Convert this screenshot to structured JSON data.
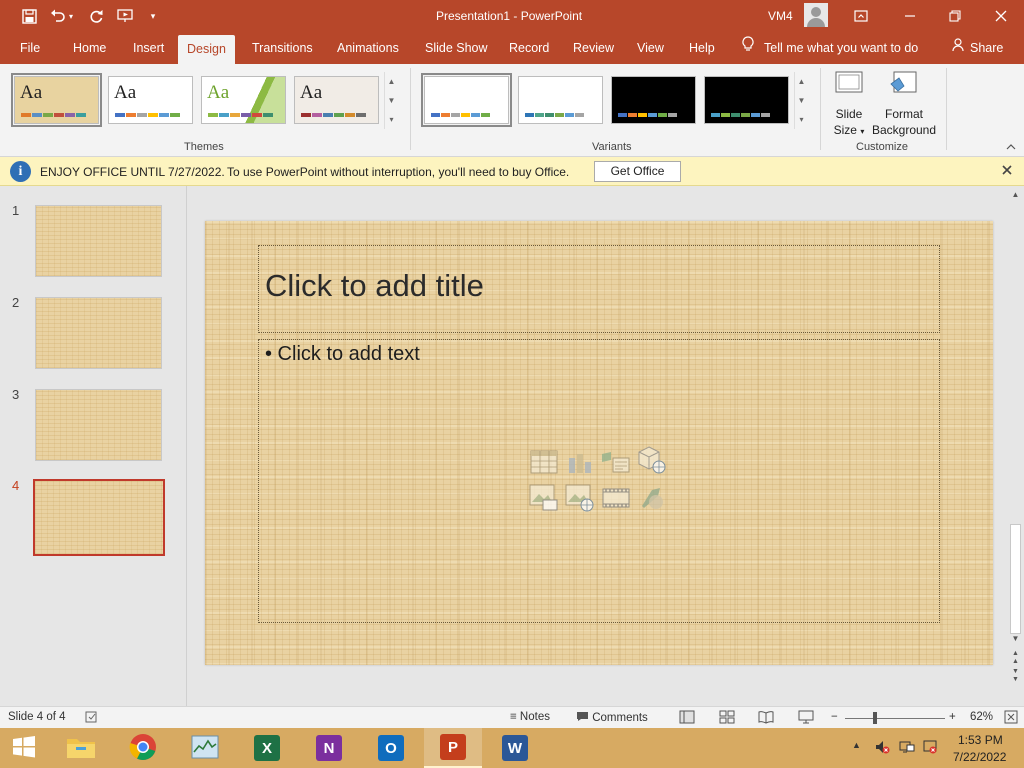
{
  "titlebar": {
    "title": "Presentation1  -  PowerPoint",
    "user": "VM4",
    "qat_icons": [
      "save-icon",
      "undo-icon",
      "undo-dropdown-icon",
      "redo-icon",
      "present-from-beginning-icon",
      "customize-qat-icon"
    ],
    "window_buttons": [
      "ribbon-display-options-icon",
      "minimize-icon",
      "restore-icon",
      "close-icon"
    ]
  },
  "ribbon_tabs": {
    "file": "File",
    "home": "Home",
    "insert": "Insert",
    "design": "Design",
    "transitions": "Transitions",
    "animations": "Animations",
    "slide_show": "Slide Show",
    "record": "Record",
    "review": "Review",
    "view": "View",
    "help": "Help",
    "tell_me": "Tell me what you want to do",
    "share": "Share",
    "active": "Design"
  },
  "ribbon": {
    "themes": {
      "label": "Themes",
      "items": [
        {
          "aa": "Aa",
          "swatches": [
            "#e07a29",
            "#5a8fc4",
            "#7aa847",
            "#c24f3b",
            "#8a63a8",
            "#3a9e9e"
          ],
          "selected": true
        },
        {
          "aa": "Aa",
          "swatches": [
            "#4472c4",
            "#ed7d31",
            "#a5a5a5",
            "#ffc000",
            "#5b9bd5",
            "#70ad47"
          ]
        },
        {
          "aa": "Aa",
          "swatches": [
            "#8dba43",
            "#4aa0c8",
            "#e8a73b",
            "#7a5ea8",
            "#d0493c",
            "#3e8e6e"
          ]
        },
        {
          "aa": "Aa",
          "swatches": [
            "#9b2f2f",
            "#b45fa0",
            "#4a7fb0",
            "#5fa14f",
            "#d48b2b",
            "#6e6e6e"
          ]
        }
      ]
    },
    "variants": {
      "label": "Variants",
      "items": [
        {
          "bg": "#ffffff",
          "swatches": [
            "#4472c4",
            "#ed7d31",
            "#a5a5a5",
            "#ffc000",
            "#5b9bd5",
            "#70ad47"
          ],
          "selected": true
        },
        {
          "bg": "#ffffff",
          "swatches": [
            "#2e75b6",
            "#4fa58a",
            "#3e8e6e",
            "#7aa847",
            "#5b9bd5",
            "#a5a5a5"
          ]
        },
        {
          "bg": "#000000",
          "swatches": [
            "#4472c4",
            "#ed7d31",
            "#ffc000",
            "#5b9bd5",
            "#70ad47",
            "#a5a5a5"
          ]
        },
        {
          "bg": "#000000",
          "swatches": [
            "#4aa0c8",
            "#8dba43",
            "#3e8e6e",
            "#7aa847",
            "#5b9bd5",
            "#a5a5a5"
          ]
        }
      ]
    },
    "customize": {
      "label": "Customize",
      "slide_size_1": "Slide",
      "slide_size_2": "Size",
      "format_bg_1": "Format",
      "format_bg_2": "Background"
    }
  },
  "message_bar": {
    "title": "ENJOY OFFICE UNTIL 7/27/2022.",
    "text": "To use PowerPoint without interruption, you'll need to buy Office.",
    "button": "Get Office"
  },
  "thumbnails": [
    {
      "num": "1"
    },
    {
      "num": "2"
    },
    {
      "num": "3"
    },
    {
      "num": "4",
      "active": true
    }
  ],
  "slide": {
    "title_placeholder": "Click to add title",
    "body_placeholder": "• Click to add text",
    "content_icons": [
      "insert-table-icon",
      "insert-chart-icon",
      "insert-smartart-icon",
      "insert-3d-model-icon",
      "insert-picture-icon",
      "insert-online-picture-icon",
      "insert-video-icon",
      "insert-icons-icon"
    ]
  },
  "statusbar": {
    "slide_info": "Slide 4 of 4",
    "notes": "Notes",
    "comments": "Comments",
    "zoom": "62%"
  },
  "taskbar": {
    "apps": [
      "start",
      "file-explorer",
      "chrome",
      "task-manager",
      "excel",
      "onenote",
      "outlook",
      "powerpoint",
      "word"
    ],
    "active_app": "powerpoint",
    "time": "1:53 PM",
    "date": "7/22/2022"
  },
  "colors": {
    "accent": "#b7472a",
    "slide_bg": "#e9d2a2",
    "message_bar": "#fdf4bf",
    "taskbar": "#d7aa62"
  }
}
